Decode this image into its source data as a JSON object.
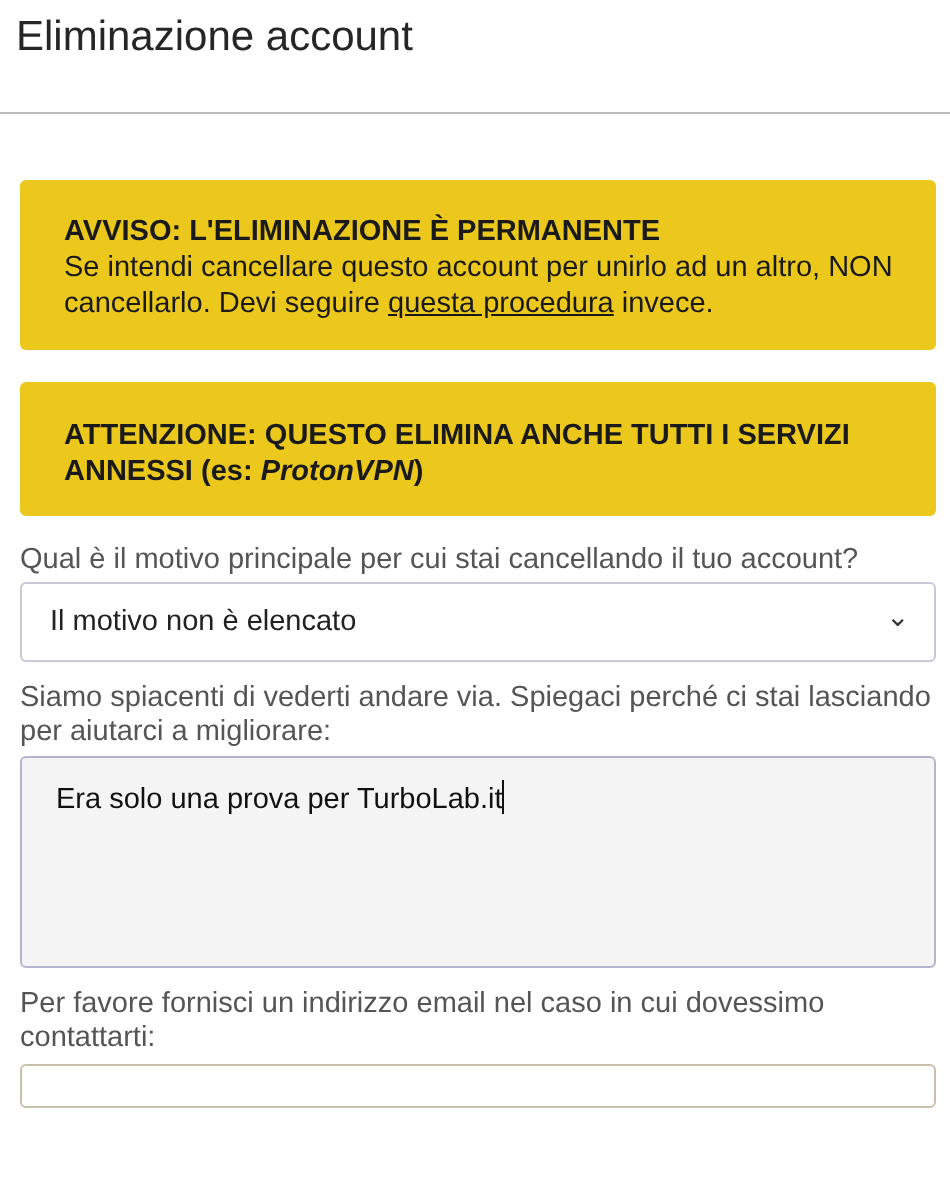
{
  "title": "Eliminazione account",
  "notices": [
    {
      "heading": "AVVISO: L'ELIMINAZIONE È PERMANENTE",
      "text_before": "Se intendi cancellare questo account per unirlo ad un altro, NON cancellarlo. Devi seguire ",
      "link": "questa procedura",
      "text_after": " invece."
    },
    {
      "heading": "ATTENZIONE: QUESTO ELIMINA ANCHE TUTTI I SERVIZI ANNESSI (es: *ProtonVPN*)"
    }
  ],
  "reason": {
    "label": "Qual è il motivo principale per cui stai cancellando il tuo account?",
    "value": "Il motivo non è elencato",
    "caret": "⌄"
  },
  "feedback": {
    "label": "Siamo spiacenti di vederti andare via. Spiegaci perché ci stai lasciando per aiutarci a migliorare:",
    "value": "Era solo una prova per TurboLab.it"
  },
  "email": {
    "label": "Per favore fornisci un indirizzo email nel caso in cui dovessimo contattarti:"
  }
}
